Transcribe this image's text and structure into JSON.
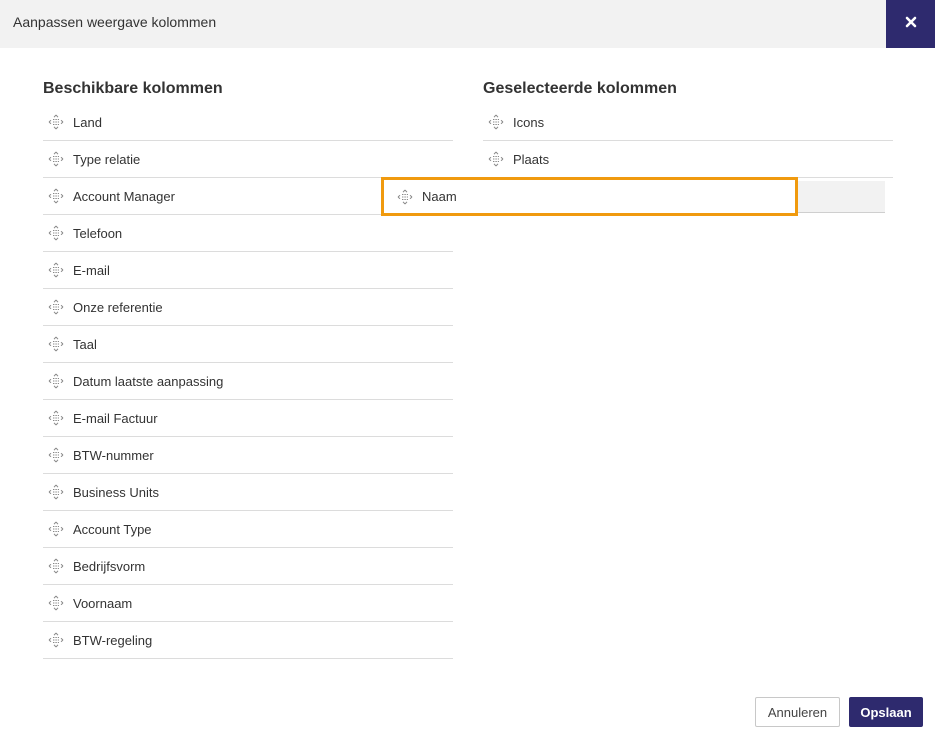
{
  "dialog": {
    "title": "Aanpassen weergave kolommen",
    "close_icon": "close-icon"
  },
  "available": {
    "title": "Beschikbare kolommen",
    "items": [
      "Land",
      "Type relatie",
      "Account Manager",
      "Telefoon",
      "E-mail",
      "Onze referentie",
      "Taal",
      "Datum laatste aanpassing",
      "E-mail Factuur",
      "BTW-nummer",
      "Business Units",
      "Account Type",
      "Bedrijfsvorm",
      "Voornaam",
      "BTW-regeling"
    ]
  },
  "selected": {
    "title": "Geselecteerde kolommen",
    "items": [
      "Icons",
      "Plaats"
    ],
    "dragging_item": "Naam"
  },
  "footer": {
    "cancel_label": "Annuleren",
    "save_label": "Opslaan"
  },
  "colors": {
    "accent": "#2e2a6e",
    "drag_highlight": "#f09a0e"
  }
}
